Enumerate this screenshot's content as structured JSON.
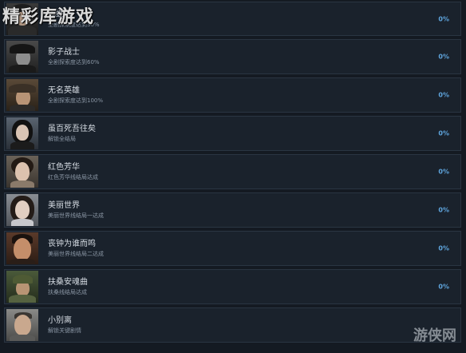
{
  "watermark": {
    "top_left": "精彩库游戏",
    "bottom_right": "游侠网"
  },
  "achievements": [
    {
      "title": "蝴蝶骑",
      "desc": "全剧探索度达到30%",
      "percent": "0%",
      "portrait": "man-dark"
    },
    {
      "title": "影子战士",
      "desc": "全剧探索度达到60%",
      "percent": "0%",
      "portrait": "man-hat-dark"
    },
    {
      "title": "无名英雄",
      "desc": "全剧探索度达到100%",
      "percent": "0%",
      "portrait": "man-hat-fedora"
    },
    {
      "title": "虽百死吾往矣",
      "desc": "解锁全结局",
      "percent": "0%",
      "portrait": "woman-bob"
    },
    {
      "title": "红色芳华",
      "desc": "红色芳华线结局达成",
      "percent": "0%",
      "portrait": "woman-short"
    },
    {
      "title": "美丽世界",
      "desc": "美丽世界线结局一达成",
      "percent": "0%",
      "portrait": "woman-long"
    },
    {
      "title": "丧钟为谁而鸣",
      "desc": "美丽世界线结局二达成",
      "percent": "0%",
      "portrait": "man-face"
    },
    {
      "title": "扶桑安魂曲",
      "desc": "扶桑线结局达成",
      "percent": "0%",
      "portrait": "soldier-cap"
    },
    {
      "title": "小别离",
      "desc": "解锁关键剧情",
      "percent": "",
      "portrait": "man-buzz"
    }
  ],
  "colors": {
    "background": "#141a22",
    "row_bg": "#1a222c",
    "row_border": "#2a3542",
    "title": "#d7dde4",
    "desc": "#8a96a4",
    "percent": "#5ea4dc"
  }
}
